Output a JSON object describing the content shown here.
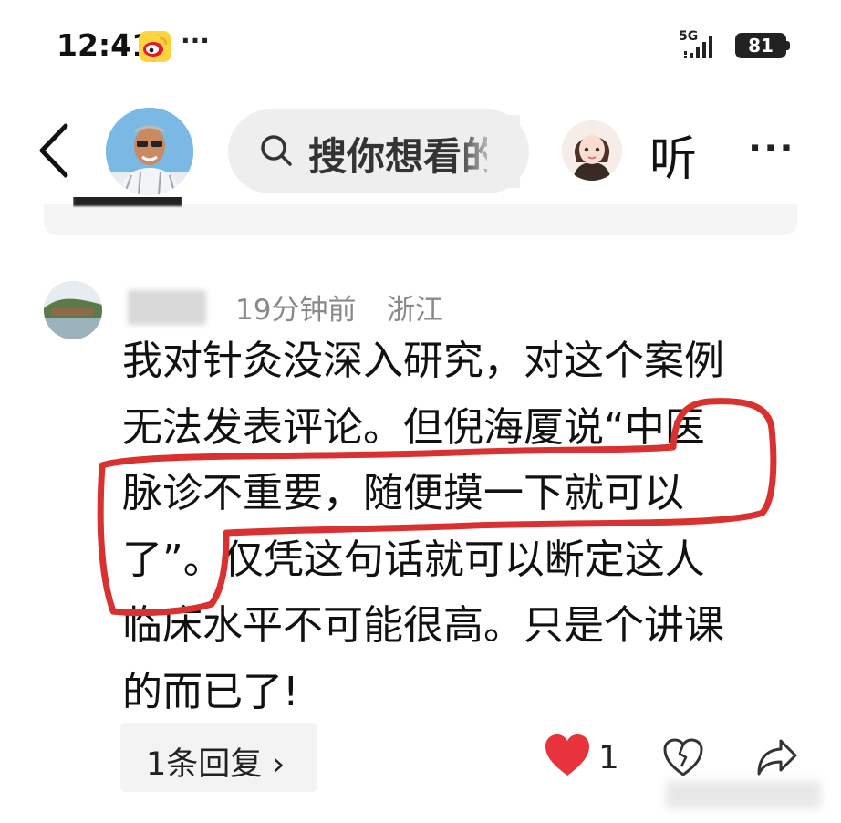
{
  "status_bar": {
    "time": "12:41",
    "dots": "···",
    "network": "5G",
    "battery": "81"
  },
  "header": {
    "search_placeholder": "搜你想看的",
    "listen_label": "听",
    "more": "···"
  },
  "comment": {
    "time_ago": "19分钟前",
    "location": "浙江",
    "lines": [
      "我对针灸没深入研究，对这个案例",
      "无法发表评论。但倪海厦说“中医",
      "脉诊不重要，随便摸一下就可以",
      "了”。仅凭这句话就可以断定这人",
      "临床水平不可能很高。只是个讲课",
      "的而已了!"
    ],
    "reply_label": "1条回复",
    "like_count": "1"
  },
  "colors": {
    "highlight": "#d9312f",
    "like": "#e8323c",
    "meta_text": "#8a8a8a",
    "search_bg": "#eeeeee"
  },
  "icons": [
    "weibo-icon",
    "signal-icon",
    "back-icon",
    "search-icon",
    "heart-icon",
    "broken-heart-icon",
    "share-icon"
  ]
}
